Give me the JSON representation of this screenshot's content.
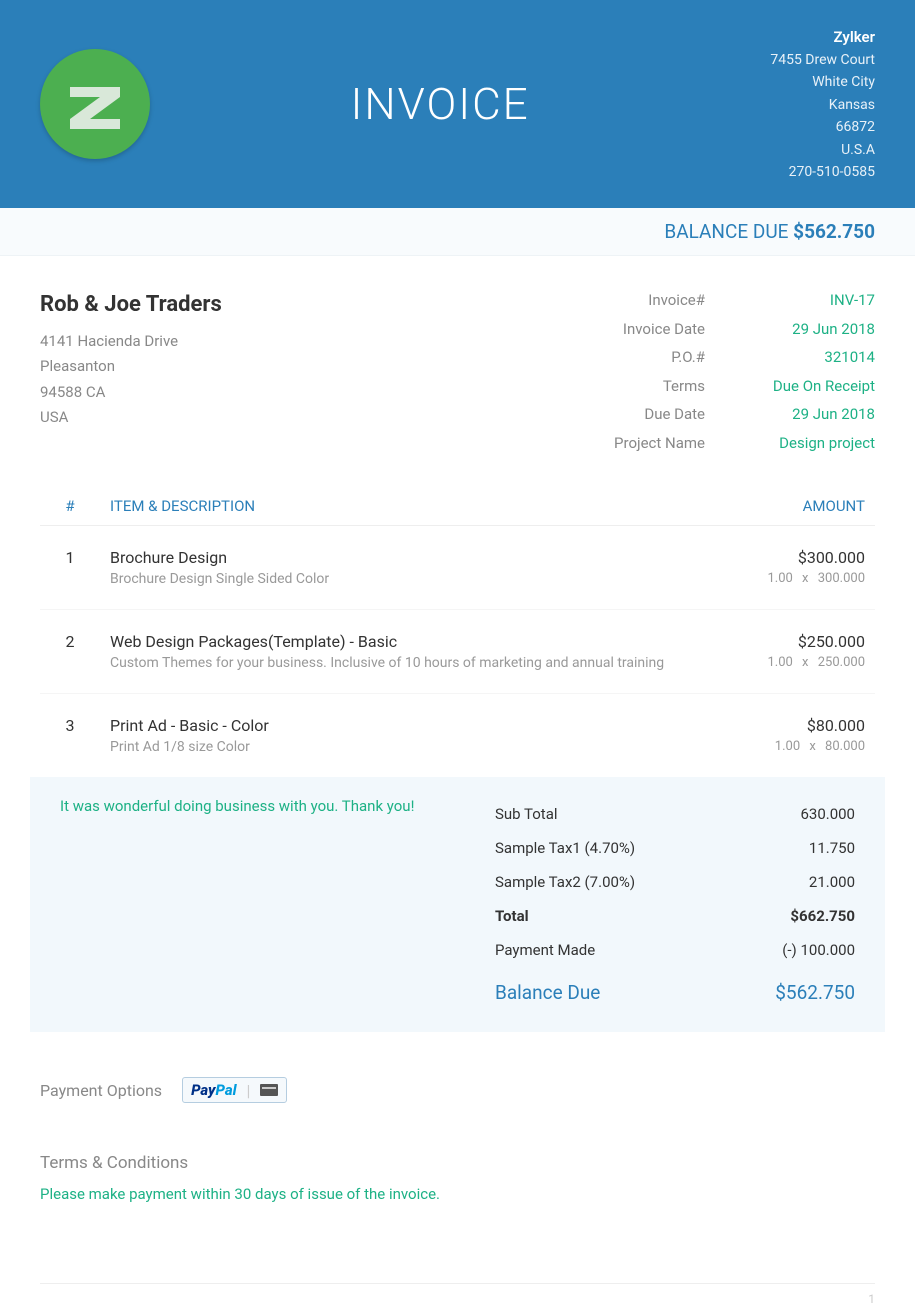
{
  "header": {
    "title": "INVOICE",
    "company": {
      "name": "Zylker",
      "addr1": "7455 Drew Court",
      "city": "White City",
      "state": "Kansas",
      "zip": "66872",
      "country": "U.S.A",
      "phone": "270-510-0585"
    }
  },
  "balance_bar": {
    "label": "BALANCE DUE ",
    "amount": "$562.750"
  },
  "bill_to": {
    "name": "Rob & Joe Traders",
    "addr1": "4141 Hacienda Drive",
    "city": "Pleasanton",
    "state_zip": "94588 CA",
    "country": "USA"
  },
  "meta": [
    {
      "label": "Invoice#",
      "value": "INV-17"
    },
    {
      "label": "Invoice Date",
      "value": "29 Jun 2018"
    },
    {
      "label": "P.O.#",
      "value": "321014"
    },
    {
      "label": "Terms",
      "value": "Due On Receipt"
    },
    {
      "label": "Due Date",
      "value": "29 Jun 2018"
    },
    {
      "label": "Project Name",
      "value": "Design project"
    }
  ],
  "table": {
    "headers": {
      "num": "#",
      "desc": "ITEM & DESCRIPTION",
      "amount": "AMOUNT"
    },
    "items": [
      {
        "num": "1",
        "name": "Brochure Design",
        "desc": "Brochure Design Single Sided Color",
        "amount": "$300.000",
        "calc": "1.00 x 300.000"
      },
      {
        "num": "2",
        "name": "Web Design Packages(Template) - Basic",
        "desc": "Custom Themes for your business. Inclusive of 10 hours of marketing and annual training",
        "amount": "$250.000",
        "calc": "1.00 x 250.000"
      },
      {
        "num": "3",
        "name": "Print Ad - Basic - Color",
        "desc": "Print Ad 1/8 size Color",
        "amount": "$80.000",
        "calc": "1.00 x 80.000"
      }
    ]
  },
  "thank_note": "It was wonderful doing business with you. Thank you!",
  "summary": [
    {
      "label": "Sub Total",
      "value": "630.000",
      "cls": ""
    },
    {
      "label": "Sample Tax1 (4.70%)",
      "value": "11.750",
      "cls": ""
    },
    {
      "label": "Sample Tax2 (7.00%)",
      "value": "21.000",
      "cls": ""
    },
    {
      "label": "Total",
      "value": "$662.750",
      "cls": "total-row"
    },
    {
      "label": "Payment Made",
      "value": "(-) 100.000",
      "cls": ""
    },
    {
      "label": "Balance Due",
      "value": "$562.750",
      "cls": "balance-row"
    }
  ],
  "payment": {
    "label": "Payment Options"
  },
  "terms": {
    "title": "Terms & Conditions",
    "text": "Please make payment within 30 days of issue of the invoice."
  },
  "page_number": "1"
}
